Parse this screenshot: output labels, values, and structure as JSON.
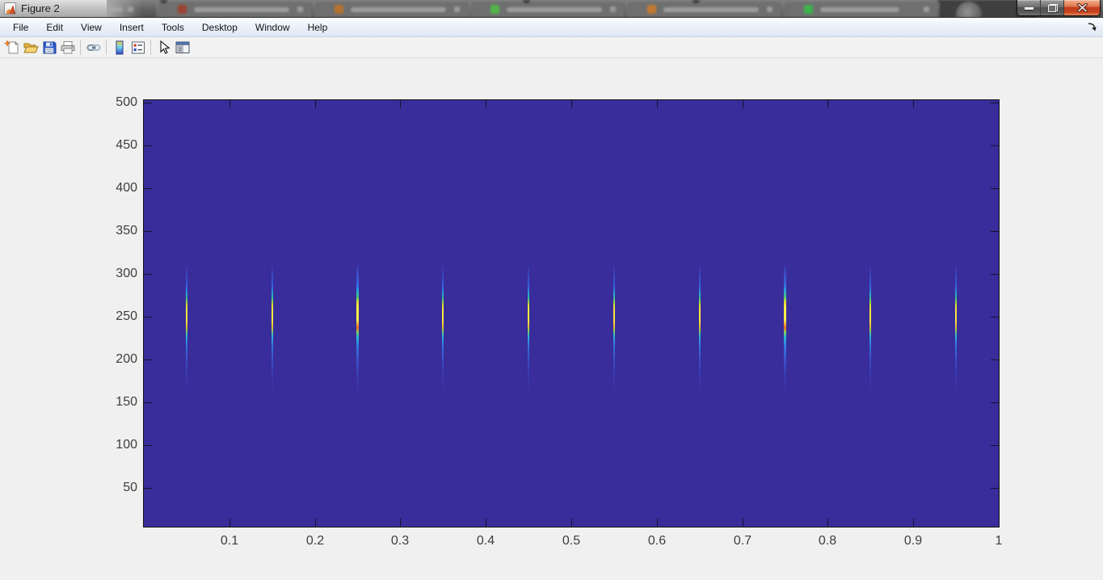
{
  "window": {
    "title": "Figure 2",
    "app_icon": "matlab-logo-icon",
    "controls": [
      {
        "name": "minimize-button",
        "icon": "minimize-icon"
      },
      {
        "name": "restore-button",
        "icon": "restore-icon"
      },
      {
        "name": "close-button",
        "icon": "close-icon"
      }
    ]
  },
  "background_tabs": {
    "legible": false,
    "items": [
      {
        "favicon_color": "#9a4636",
        "label": ""
      },
      {
        "favicon_color": "#b5712f",
        "label": ""
      },
      {
        "favicon_color": "#52b44a",
        "label": ""
      },
      {
        "favicon_color": "#c07a35",
        "label": ""
      },
      {
        "favicon_color": "#3cb24a",
        "label": ""
      }
    ]
  },
  "menu": {
    "items": [
      "File",
      "Edit",
      "View",
      "Insert",
      "Tools",
      "Desktop",
      "Window",
      "Help"
    ]
  },
  "toolbar": {
    "items": [
      {
        "name": "new-figure-button",
        "icon": "new-document-icon"
      },
      {
        "name": "open-file-button",
        "icon": "open-folder-icon"
      },
      {
        "name": "save-figure-button",
        "icon": "save-icon"
      },
      {
        "name": "print-figure-button",
        "icon": "print-icon"
      },
      {
        "type": "separator"
      },
      {
        "name": "link-plot-button",
        "icon": "link-plot-icon"
      },
      {
        "type": "separator"
      },
      {
        "name": "insert-colorbar-button",
        "icon": "colorbar-icon"
      },
      {
        "name": "insert-legend-button",
        "icon": "legend-icon"
      },
      {
        "type": "separator"
      },
      {
        "name": "edit-plot-button",
        "icon": "edit-plot-arrow-icon"
      },
      {
        "name": "show-plot-tools-button",
        "icon": "plot-tools-icon"
      }
    ]
  },
  "dock_button": {
    "name": "dock-figure-button",
    "icon": "dock-arrow-icon"
  },
  "chart_data": {
    "type": "heatmap",
    "title": "",
    "xlabel": "",
    "ylabel": "",
    "xlim": [
      0,
      1
    ],
    "ylim": [
      5,
      503
    ],
    "x_ticks": [
      0.1,
      0.2,
      0.3,
      0.4,
      0.5,
      0.6,
      0.7,
      0.8,
      0.9,
      1
    ],
    "x_tick_labels": [
      "0.1",
      "0.2",
      "0.3",
      "0.4",
      "0.5",
      "0.6",
      "0.7",
      "0.8",
      "0.9",
      "1"
    ],
    "y_ticks": [
      50,
      100,
      150,
      200,
      250,
      300,
      350,
      400,
      450,
      500
    ],
    "y_tick_labels": [
      "50",
      "100",
      "150",
      "200",
      "250",
      "300",
      "350",
      "400",
      "450",
      "500"
    ],
    "grid": false,
    "legend": false,
    "colormap": "parula",
    "background_color": "#392d9b",
    "pulses": {
      "x_centers": [
        0.05,
        0.15,
        0.25,
        0.35,
        0.45,
        0.55,
        0.65,
        0.75,
        0.85,
        0.95
      ],
      "y_center": 250,
      "y_visible_extent": [
        160,
        312
      ],
      "y_core_extent": [
        238,
        269
      ],
      "bright_indices": [
        2,
        7
      ],
      "peak_color": "#fbe93e",
      "gradient_stops": [
        [
          0,
          "rgba(57,60,170,0)"
        ],
        [
          0.07,
          "rgba(60,73,194,0.75)"
        ],
        [
          0.17,
          "#3263dc"
        ],
        [
          0.225,
          "#2b9fd4"
        ],
        [
          0.265,
          "#35c08c"
        ],
        [
          0.295,
          "#a8d83f"
        ],
        [
          0.33,
          "#f2e43c"
        ],
        [
          0.44,
          "#fbe93e"
        ],
        [
          0.475,
          "#f3b83a"
        ],
        [
          0.51,
          "#8fd048"
        ],
        [
          0.55,
          "#2cb6d4"
        ],
        [
          0.63,
          "#3272dc"
        ],
        [
          0.74,
          "#3a4ec6"
        ],
        [
          0.84,
          "rgba(60,70,190,0.5)"
        ],
        [
          1,
          "rgba(57,60,170,0)"
        ]
      ],
      "gradient_stops_bright": [
        [
          0,
          "rgba(57,60,170,0)"
        ],
        [
          0.06,
          "rgba(62,76,200,0.85)"
        ],
        [
          0.16,
          "#3468e0"
        ],
        [
          0.21,
          "#28a8d8"
        ],
        [
          0.25,
          "#3ec47e"
        ],
        [
          0.28,
          "#b8dc3c"
        ],
        [
          0.3,
          "#f0d43a"
        ],
        [
          0.33,
          "#fdee45"
        ],
        [
          0.43,
          "#fdee45"
        ],
        [
          0.46,
          "#f5a434"
        ],
        [
          0.49,
          "#e86c2a"
        ],
        [
          0.52,
          "#8fd048"
        ],
        [
          0.56,
          "#28b8d8"
        ],
        [
          0.64,
          "#3272dc"
        ],
        [
          0.75,
          "#3a4ec6"
        ],
        [
          0.86,
          "rgba(60,70,190,0.5)"
        ],
        [
          1,
          "rgba(57,60,170,0)"
        ]
      ]
    }
  },
  "colors": {
    "figure_background": "#f0f0f0",
    "axes_border": "#151515",
    "tick_label": "#3e3e3e",
    "menubar_top": "#fbfdff",
    "menubar_bottom": "#dde7f3",
    "titlebar_glass": "#c9c9c9",
    "titlebar_dark": "#616161",
    "close_button_red": "#c8461f"
  }
}
